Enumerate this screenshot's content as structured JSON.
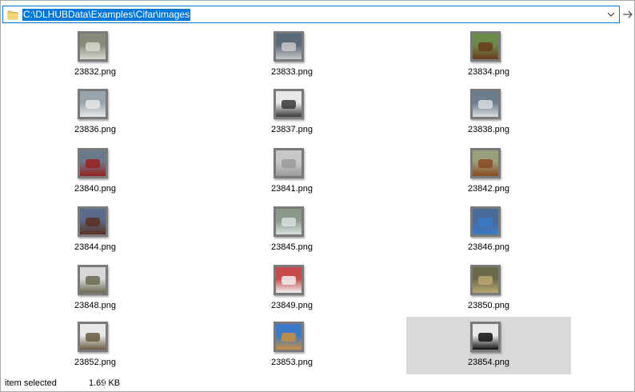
{
  "address_bar": {
    "path": "C:\\DLHUBData\\Examples\\Cifar\\images"
  },
  "files": [
    {
      "name": "23832.png",
      "selected": false
    },
    {
      "name": "23833.png",
      "selected": false
    },
    {
      "name": "23834.png",
      "selected": false
    },
    {
      "name": "23836.png",
      "selected": false
    },
    {
      "name": "23837.png",
      "selected": false
    },
    {
      "name": "23838.png",
      "selected": false
    },
    {
      "name": "23840.png",
      "selected": false
    },
    {
      "name": "23841.png",
      "selected": false
    },
    {
      "name": "23842.png",
      "selected": false
    },
    {
      "name": "23844.png",
      "selected": false
    },
    {
      "name": "23845.png",
      "selected": false
    },
    {
      "name": "23846.png",
      "selected": false
    },
    {
      "name": "23848.png",
      "selected": false
    },
    {
      "name": "23849.png",
      "selected": false
    },
    {
      "name": "23850.png",
      "selected": false
    },
    {
      "name": "23852.png",
      "selected": false
    },
    {
      "name": "23853.png",
      "selected": false
    },
    {
      "name": "23854.png",
      "selected": true
    }
  ],
  "status_bar": {
    "selection": "item selected",
    "size": "1.69 KB"
  },
  "colors": {
    "accent": "#0078d7",
    "selection_bg": "#d9d9d9",
    "folder": "#e8c25c"
  }
}
